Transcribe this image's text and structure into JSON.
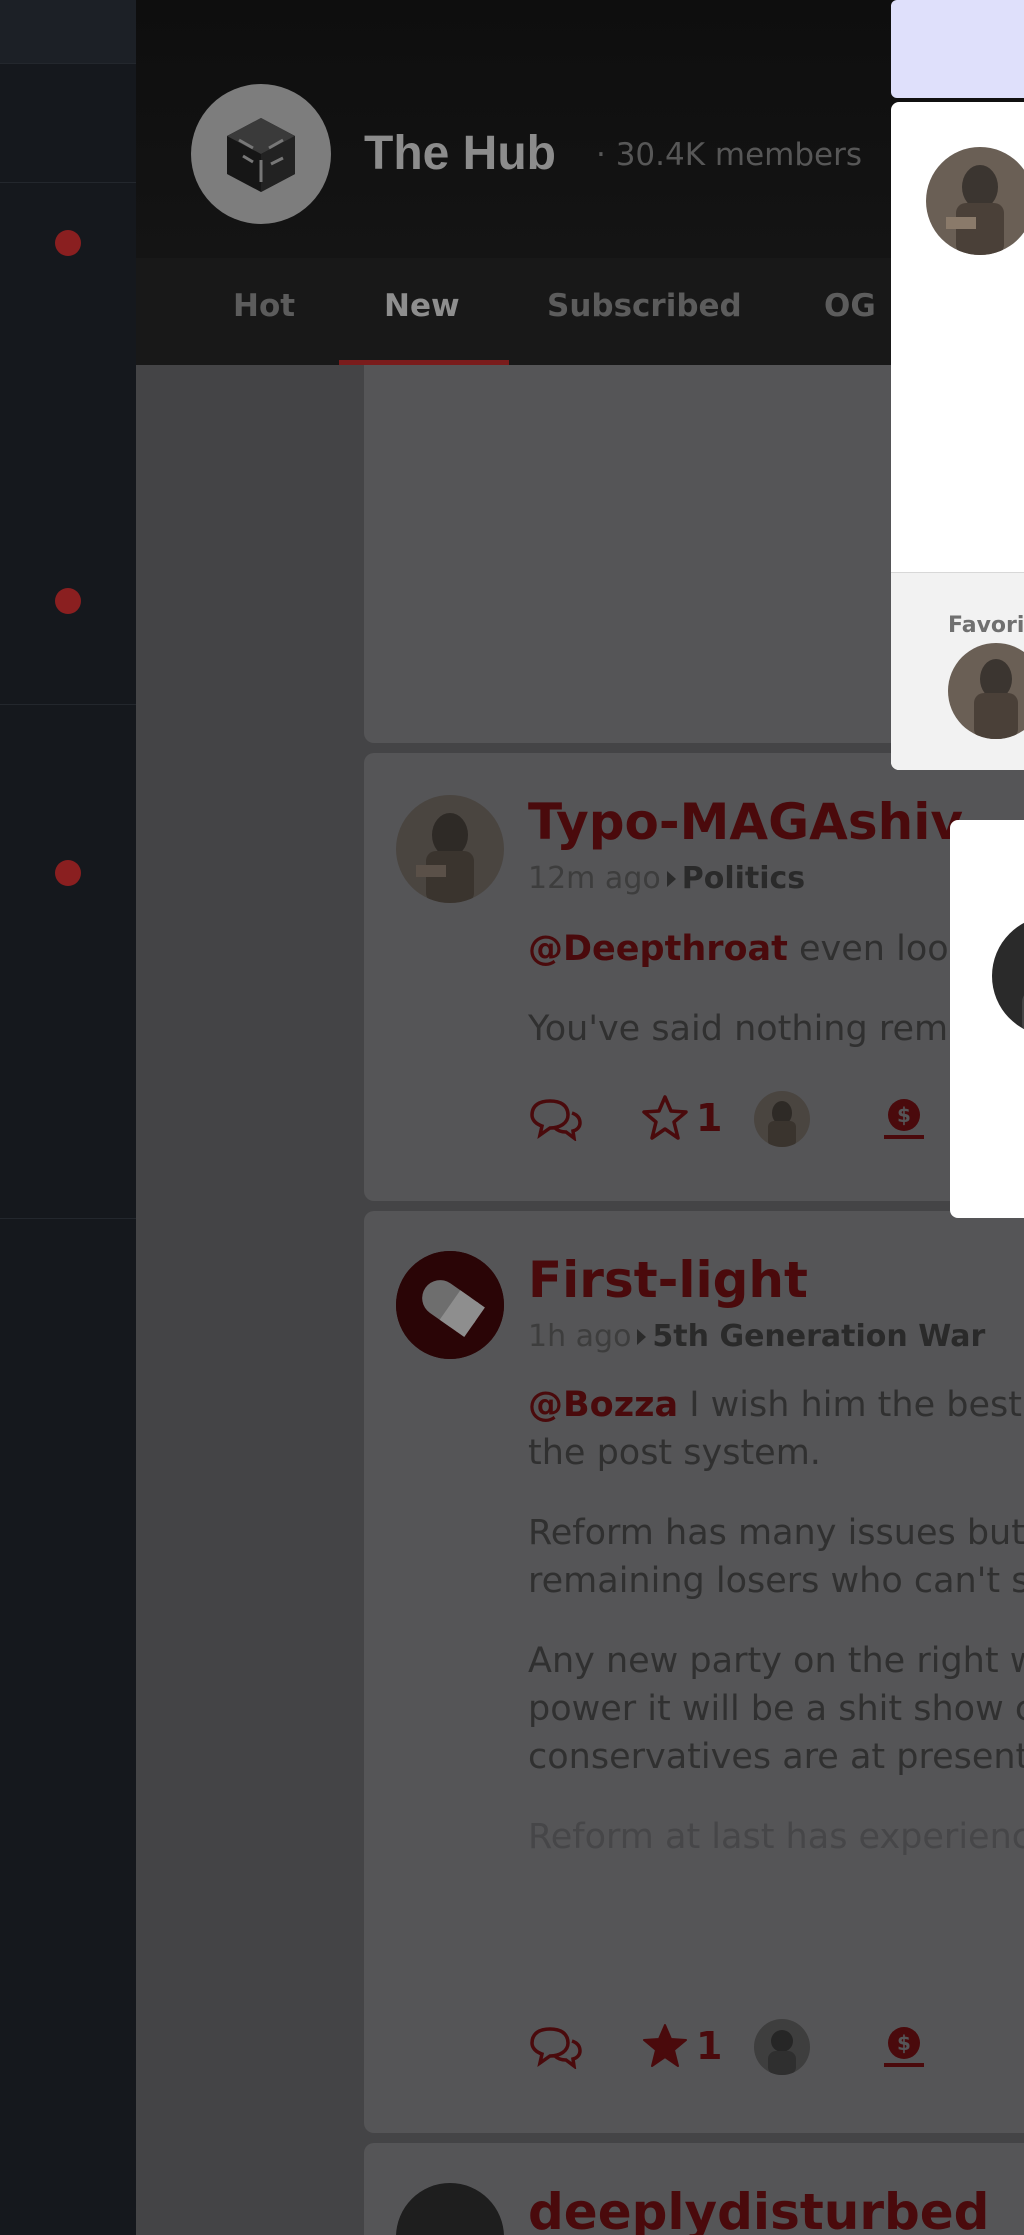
{
  "community": {
    "name": "The Hub",
    "members": "· 30.4K members"
  },
  "tabs": [
    {
      "label": "Hot"
    },
    {
      "label": "New"
    },
    {
      "label": "Subscribed"
    },
    {
      "label": "OG"
    }
  ],
  "posts": [
    {
      "author": "Typo-MAGAshiv",
      "ago": "12m ago",
      "category": "Politics",
      "mention": "@Deepthroat",
      "line1_rest": " even look",
      "line2": "You've said nothing rem",
      "stars": "1",
      "starred": false
    },
    {
      "author": "First-light",
      "ago": "1h ago",
      "category": "5th Generation War",
      "mention": "@Bozza",
      "line1_rest": " I wish him the best",
      "line2": "the post system.",
      "para2_line1": "Reform has many issues but",
      "para2_line2": "remaining losers who can't s",
      "para3_line1": "Any new party on the right w",
      "para3_line2": "power it will be a shit show c",
      "para3_line3": "conservatives are at present",
      "para4_line1": "Reform at last has experienc",
      "stars": "1",
      "starred": true
    },
    {
      "author": "deeplydisturbed"
    }
  ],
  "popover": {
    "favorites_label": "Favori"
  },
  "colors": {
    "accent": "#7a1c1c",
    "author": "#4a0a0c",
    "sidebar_dot": "#8a1f20"
  }
}
